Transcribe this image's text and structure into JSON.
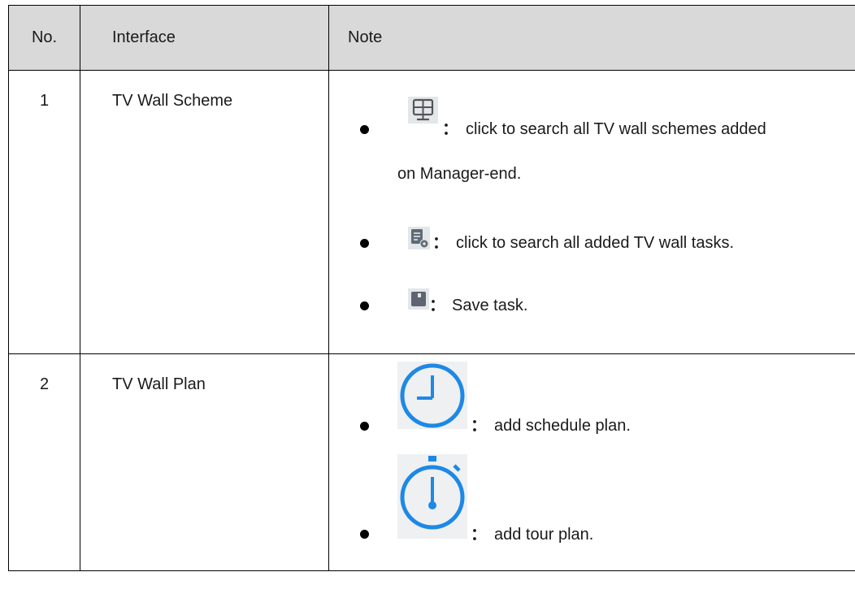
{
  "header": {
    "no": "No.",
    "interface": "Interface",
    "note": "Note"
  },
  "rows": [
    {
      "no": "1",
      "interface": "TV Wall Scheme",
      "notes": [
        {
          "icon": "tv-wall-scheme-icon",
          "text_line1": "click to search all TV wall schemes added",
          "text_line2": "on Manager-end."
        },
        {
          "icon": "task-settings-icon",
          "text": "click to search all added TV wall tasks."
        },
        {
          "icon": "save-icon",
          "text": "Save task."
        }
      ]
    },
    {
      "no": "2",
      "interface": "TV Wall Plan",
      "notes": [
        {
          "icon": "clock-icon",
          "text": "add schedule plan."
        },
        {
          "icon": "stopwatch-icon",
          "text": "add tour plan."
        }
      ]
    }
  ],
  "colon": "："
}
